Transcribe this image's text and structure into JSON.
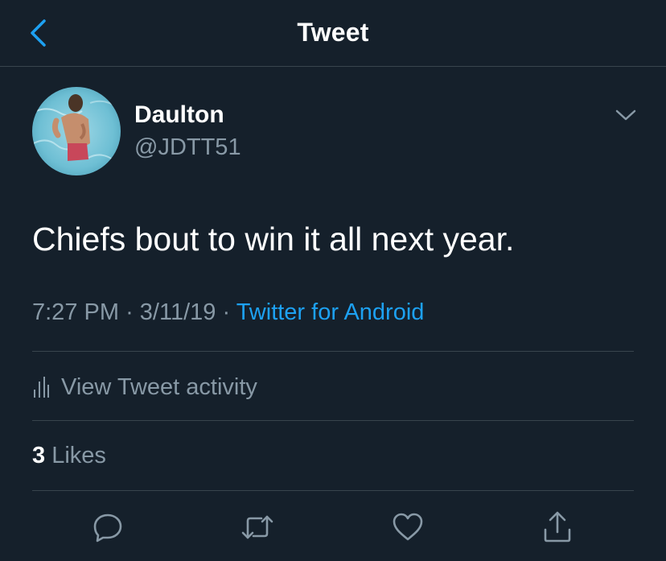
{
  "header": {
    "title": "Tweet",
    "back_icon": "chevron-left-icon"
  },
  "author": {
    "name": "Daulton",
    "handle": "@JDTT51"
  },
  "tweet": {
    "text": "Chiefs bout to win it all next year.",
    "time": "7:27 PM",
    "separator": "·",
    "date": "3/11/19",
    "source": "Twitter for Android"
  },
  "activity": {
    "label": "View Tweet activity",
    "icon": "bar-chart-icon"
  },
  "likes": {
    "count": "3",
    "label": "Likes"
  },
  "actions": {
    "reply_icon": "reply-icon",
    "retweet_icon": "retweet-icon",
    "like_icon": "heart-icon",
    "share_icon": "share-icon"
  },
  "colors": {
    "background": "#15202b",
    "accent": "#1da1f2",
    "secondary_text": "#8899a6",
    "divider": "#38444d"
  }
}
